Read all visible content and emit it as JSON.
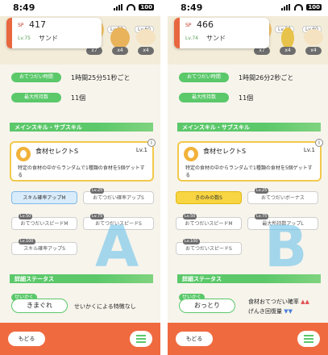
{
  "status": {
    "time": "8:49",
    "battery": "100"
  },
  "left": {
    "sp_label": "SP",
    "sp_value": "417",
    "level": "Lv.75",
    "name": "サンド",
    "bag_levels": [
      "Lv.30",
      "Lv.60"
    ],
    "bag_counts": [
      "x7",
      "x4",
      "x4"
    ],
    "help_label": "おてつだい時間",
    "help_value": "1時間25分51秒ごと",
    "max_label": "最大所持数",
    "max_value": "11個",
    "section_skills": "メインスキル・サブスキル",
    "skill_title": "食材セレクトS",
    "skill_lv": "Lv.1",
    "skill_desc": "特定の食材の中からランダムで1種類の食材を5個ゲットする",
    "subs": [
      {
        "label": "スキル確率アップM",
        "lv": ""
      },
      {
        "label": "おてつだい確率アップS",
        "lv": "Lv.25"
      },
      {
        "label": "おてつだいスピードM",
        "lv": "Lv.50"
      },
      {
        "label": "おてつだいスピードS",
        "lv": "Lv.75"
      },
      {
        "label": "スキル確率アップS",
        "lv": "Lv.100"
      }
    ],
    "letter": "A",
    "section_detail": "詳細ステータス",
    "nature_label": "せいかく",
    "nature": "きまぐれ",
    "nature_effect": "せいかくによる特徴なし",
    "back": "もどる"
  },
  "right": {
    "sp_label": "SP",
    "sp_value": "466",
    "level": "Lv.74",
    "name": "サンド",
    "bag_levels": [
      "Lv.30",
      "Lv.60"
    ],
    "bag_counts": [
      "x7",
      "x4",
      "x4"
    ],
    "help_label": "おてつだい時間",
    "help_value": "1時間26分2秒ごと",
    "max_label": "最大所持数",
    "max_value": "11個",
    "section_skills": "メインスキル・サブスキル",
    "skill_title": "食材セレクトS",
    "skill_lv": "Lv.1",
    "skill_desc": "特定の食材の中からランダムで1種類の食材を5個ゲットする",
    "subs": [
      {
        "label": "きのみの数S",
        "lv": ""
      },
      {
        "label": "おてつだいボーナス",
        "lv": "Lv.25"
      },
      {
        "label": "おてつだいスピードM",
        "lv": "Lv.50"
      },
      {
        "label": "最大所持数アップL",
        "lv": "Lv.75"
      },
      {
        "label": "おてつだいスピードS",
        "lv": "Lv.100"
      }
    ],
    "letter": "B",
    "section_detail": "詳細ステータス",
    "nature_label": "せいかく",
    "nature": "おっとり",
    "nature_up": "食材おてつだい確率",
    "nature_up_marks": "▲▲",
    "nature_down": "げんき回復量",
    "nature_down_marks": "▼▼",
    "back": "もどる"
  }
}
